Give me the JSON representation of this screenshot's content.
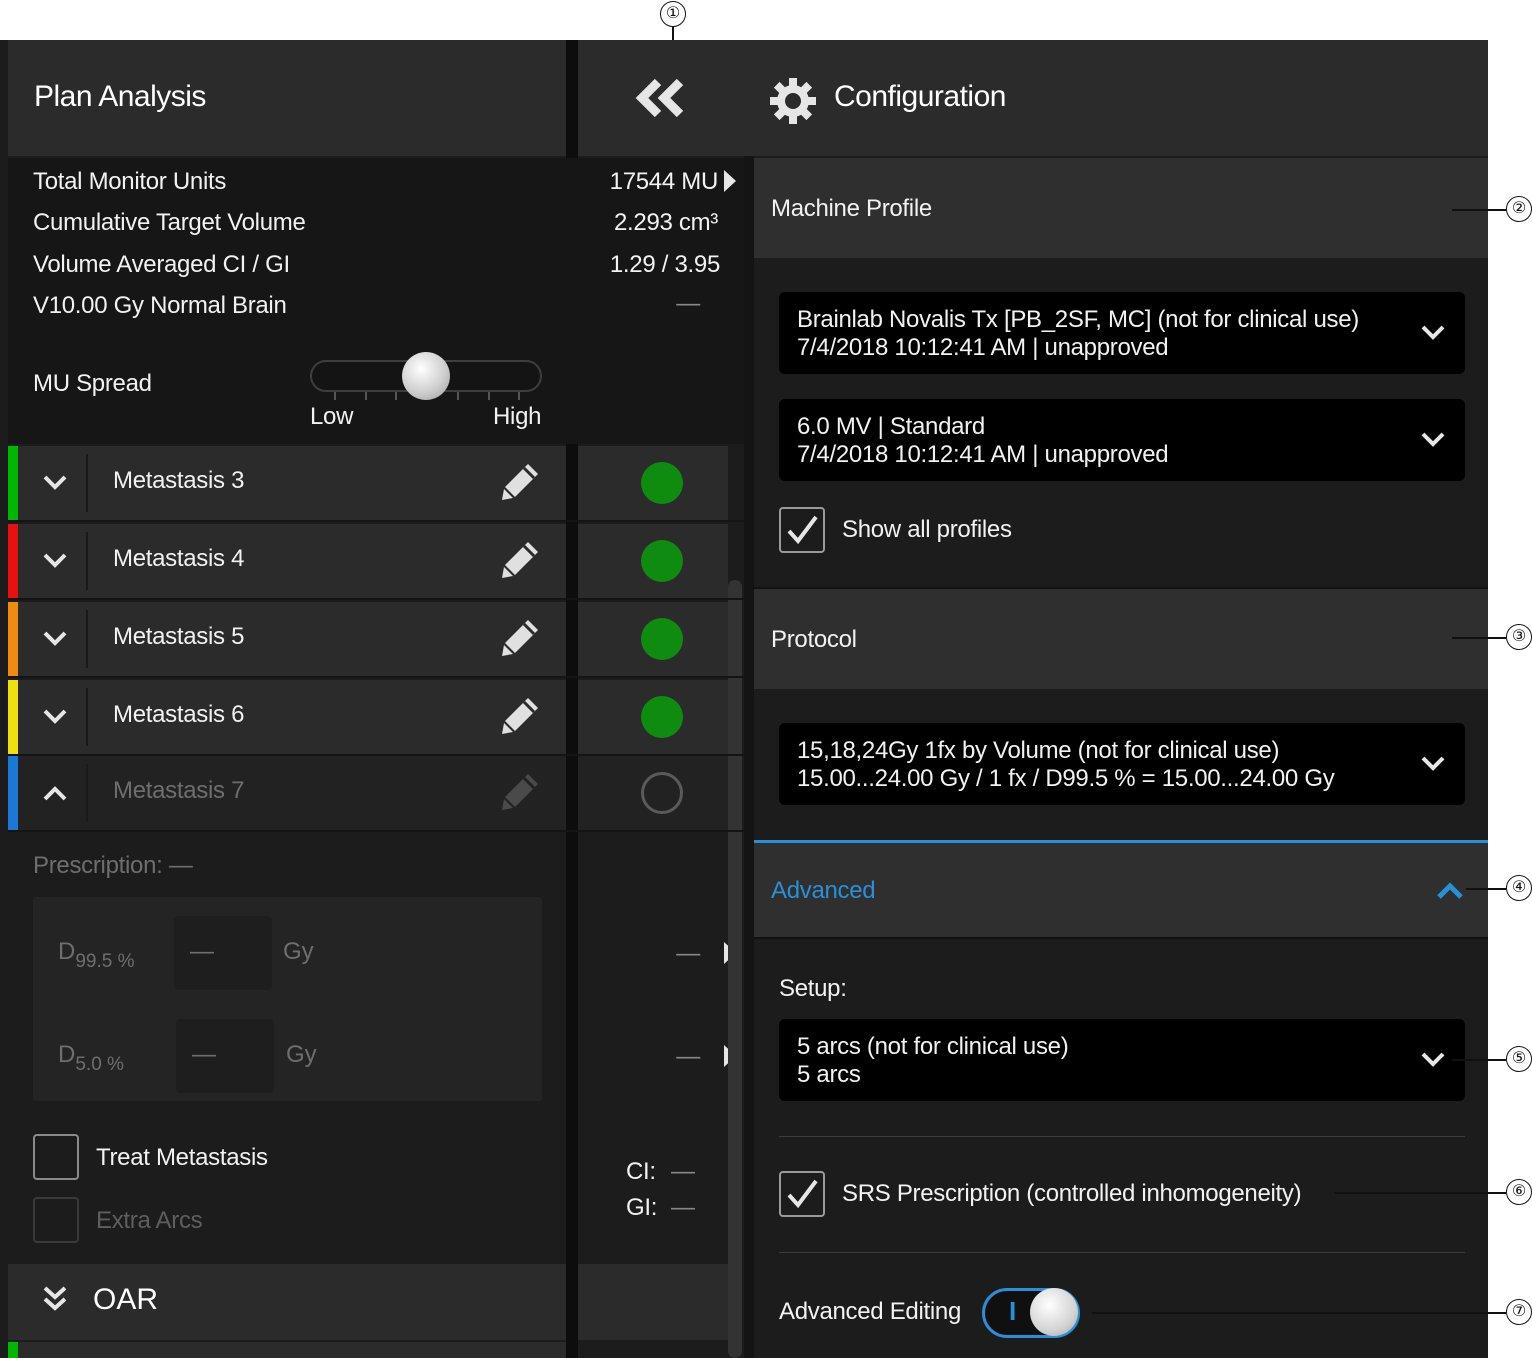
{
  "header": {
    "left_title": "Plan Analysis",
    "right_title": "Configuration"
  },
  "metrics": [
    {
      "label": "Total Monitor Units",
      "value": "17544 MU"
    },
    {
      "label": "Cumulative Target Volume",
      "value": "2.293 cm³"
    },
    {
      "label": "Volume Averaged CI / GI",
      "value": "1.29 / 3.95"
    },
    {
      "label": "V10.00 Gy Normal Brain",
      "value": "—"
    }
  ],
  "mu_spread": {
    "label": "MU Spread",
    "low_label": "Low",
    "high_label": "High",
    "level": 0.5
  },
  "metastases": [
    {
      "name": "Metastasis 3",
      "color": "#00b800",
      "status": "ok"
    },
    {
      "name": "Metastasis 4",
      "color": "#e81010",
      "status": "ok"
    },
    {
      "name": "Metastasis 5",
      "color": "#f08a10",
      "status": "ok"
    },
    {
      "name": "Metastasis 6",
      "color": "#f0e010",
      "status": "ok"
    },
    {
      "name": "Metastasis 7",
      "color": "#1a78d8",
      "status": "none"
    }
  ],
  "prescription": {
    "label": "Prescription: —",
    "d1_label": "D",
    "d1_sub": "99.5 %",
    "d1_value": "—",
    "d1_unit": "Gy",
    "d2_label": "D",
    "d2_sub": "5.0 %",
    "d2_value": "—",
    "d2_unit": "Gy",
    "d1_mid": "—",
    "d2_mid": "—",
    "treat_label": "Treat Metastasis",
    "extra_label": "Extra Arcs",
    "ci_label": "CI:",
    "ci_value": "—",
    "gi_label": "GI:",
    "gi_value": "—"
  },
  "oar": {
    "label": "OAR"
  },
  "machine_profile": {
    "title": "Machine Profile",
    "profile_line1": "Brainlab Novalis Tx [PB_2SF, MC] (not for clinical use)",
    "profile_line2": "7/4/2018 10:12:41 AM | unapproved",
    "energy_line1": "6.0 MV | Standard",
    "energy_line2": "7/4/2018 10:12:41 AM | unapproved",
    "show_all_label": "Show all profiles",
    "show_all_checked": true
  },
  "protocol": {
    "title": "Protocol",
    "line1": "15,18,24Gy 1fx by Volume (not for clinical use)",
    "line2": "15.00...24.00 Gy / 1 fx / D99.5 % = 15.00...24.00 Gy"
  },
  "advanced": {
    "title": "Advanced",
    "setup_label": "Setup:",
    "setup_line1": "5 arcs (not for clinical use)",
    "setup_line2": "5 arcs",
    "srs_label": "SRS Prescription (controlled inhomogeneity)",
    "srs_checked": true,
    "adv_edit_label": "Advanced Editing",
    "toggle_glyph": "I"
  },
  "callouts": [
    "①",
    "②",
    "③",
    "④",
    "⑤",
    "⑥",
    "⑦"
  ],
  "colors": {
    "accent": "#2a8fd6",
    "ok": "#0f8c0f"
  }
}
